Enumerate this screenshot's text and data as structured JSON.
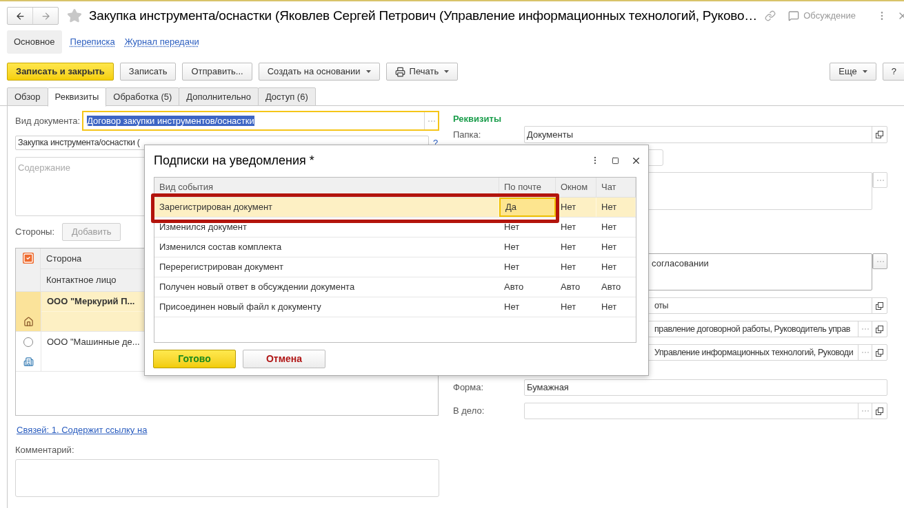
{
  "window": {
    "title": "Закупка инструмента/оснастки (Яковлев Сергей Петрович (Управление информационных технологий, Руково…",
    "discussion": "Обсуждение"
  },
  "nav": [
    {
      "label": "Основное",
      "selected": true
    },
    {
      "label": "Переписка",
      "selected": false
    },
    {
      "label": "Журнал передачи",
      "selected": false
    }
  ],
  "toolbar": [
    {
      "label": "Записать и закрыть",
      "kind": "primary"
    },
    {
      "label": "Записать",
      "kind": "plain"
    },
    {
      "label": "Отправить...",
      "kind": "plain"
    },
    {
      "label": "Создать на основании",
      "kind": "menu"
    },
    {
      "label": "Печать",
      "kind": "print"
    }
  ],
  "toolbar_right": [
    {
      "label": "Еще",
      "kind": "menu"
    },
    {
      "label": "?",
      "kind": "plain"
    }
  ],
  "tabs": [
    {
      "label": "Обзор",
      "selected": false
    },
    {
      "label": "Реквизиты",
      "selected": true
    },
    {
      "label": "Обработка (5)",
      "selected": false
    },
    {
      "label": "Дополнительно",
      "selected": false
    },
    {
      "label": "Доступ (6)",
      "selected": false
    }
  ],
  "left": {
    "doc_type_label": "Вид документа:",
    "doc_type_value": "Договор закупки инструментов/оснастки",
    "doc_title": "Закупка инструмента/оснастки (",
    "help": "?",
    "content_placeholder": "Содержание",
    "parties_label": "Стороны:",
    "add_button": "Добавить",
    "parties_columns": [
      "Сторона",
      "Контактное лицо"
    ],
    "parties": [
      {
        "name": "ООО \"Меркурий П...",
        "selected": true,
        "kind": "home"
      },
      {
        "name": "ООО \"Машинные де...",
        "selected": false,
        "kind": "office"
      }
    ],
    "links": "Связей: 1. Содержит ссылку на",
    "comment_label": "Комментарий:"
  },
  "right": {
    "heading": "Реквизиты",
    "folder_label": "Папка:",
    "folder_value": "Документы",
    "approval_tail": "согласовании",
    "field_tails": [
      "оты",
      "правление договорной работы, Руководитель управ",
      "Управление информационных технологий, Руководи"
    ],
    "form_label": "Форма:",
    "form_value": "Бумажная",
    "file_label": "В дело:"
  },
  "dialog": {
    "title": "Подписки на уведомления *",
    "columns": [
      "Вид события",
      "По почте",
      "Окном",
      "Чат"
    ],
    "rows": [
      {
        "cells": [
          {
            "text": "Зарегистрирован документ",
            "focused": false
          },
          {
            "text": "Да",
            "focused": true
          },
          {
            "text": "Нет",
            "focused": false
          },
          {
            "text": "Нет",
            "focused": false
          }
        ],
        "selected": true,
        "highlighted": true
      },
      {
        "cells": [
          {
            "text": "Изменился документ",
            "focused": false
          },
          {
            "text": "Нет",
            "focused": false
          },
          {
            "text": "Нет",
            "focused": false
          },
          {
            "text": "Нет",
            "focused": false
          }
        ],
        "selected": false,
        "highlighted": false
      },
      {
        "cells": [
          {
            "text": "Изменился состав комплекта",
            "focused": false
          },
          {
            "text": "Нет",
            "focused": false
          },
          {
            "text": "Нет",
            "focused": false
          },
          {
            "text": "Нет",
            "focused": false
          }
        ],
        "selected": false,
        "highlighted": false
      },
      {
        "cells": [
          {
            "text": "Перерегистрирован документ",
            "focused": false
          },
          {
            "text": "Нет",
            "focused": false
          },
          {
            "text": "Нет",
            "focused": false
          },
          {
            "text": "Нет",
            "focused": false
          }
        ],
        "selected": false,
        "highlighted": false
      },
      {
        "cells": [
          {
            "text": "Получен новый ответ в обсуждении документа",
            "focused": false
          },
          {
            "text": "Авто",
            "focused": false
          },
          {
            "text": "Авто",
            "focused": false
          },
          {
            "text": "Авто",
            "focused": false
          }
        ],
        "selected": false,
        "highlighted": false
      },
      {
        "cells": [
          {
            "text": "Присоединен новый файл к документу",
            "focused": false
          },
          {
            "text": "Нет",
            "focused": false
          },
          {
            "text": "Нет",
            "focused": false
          },
          {
            "text": "Нет",
            "focused": false
          }
        ],
        "selected": false,
        "highlighted": false
      }
    ],
    "ok": "Готово",
    "cancel": "Отмена"
  }
}
